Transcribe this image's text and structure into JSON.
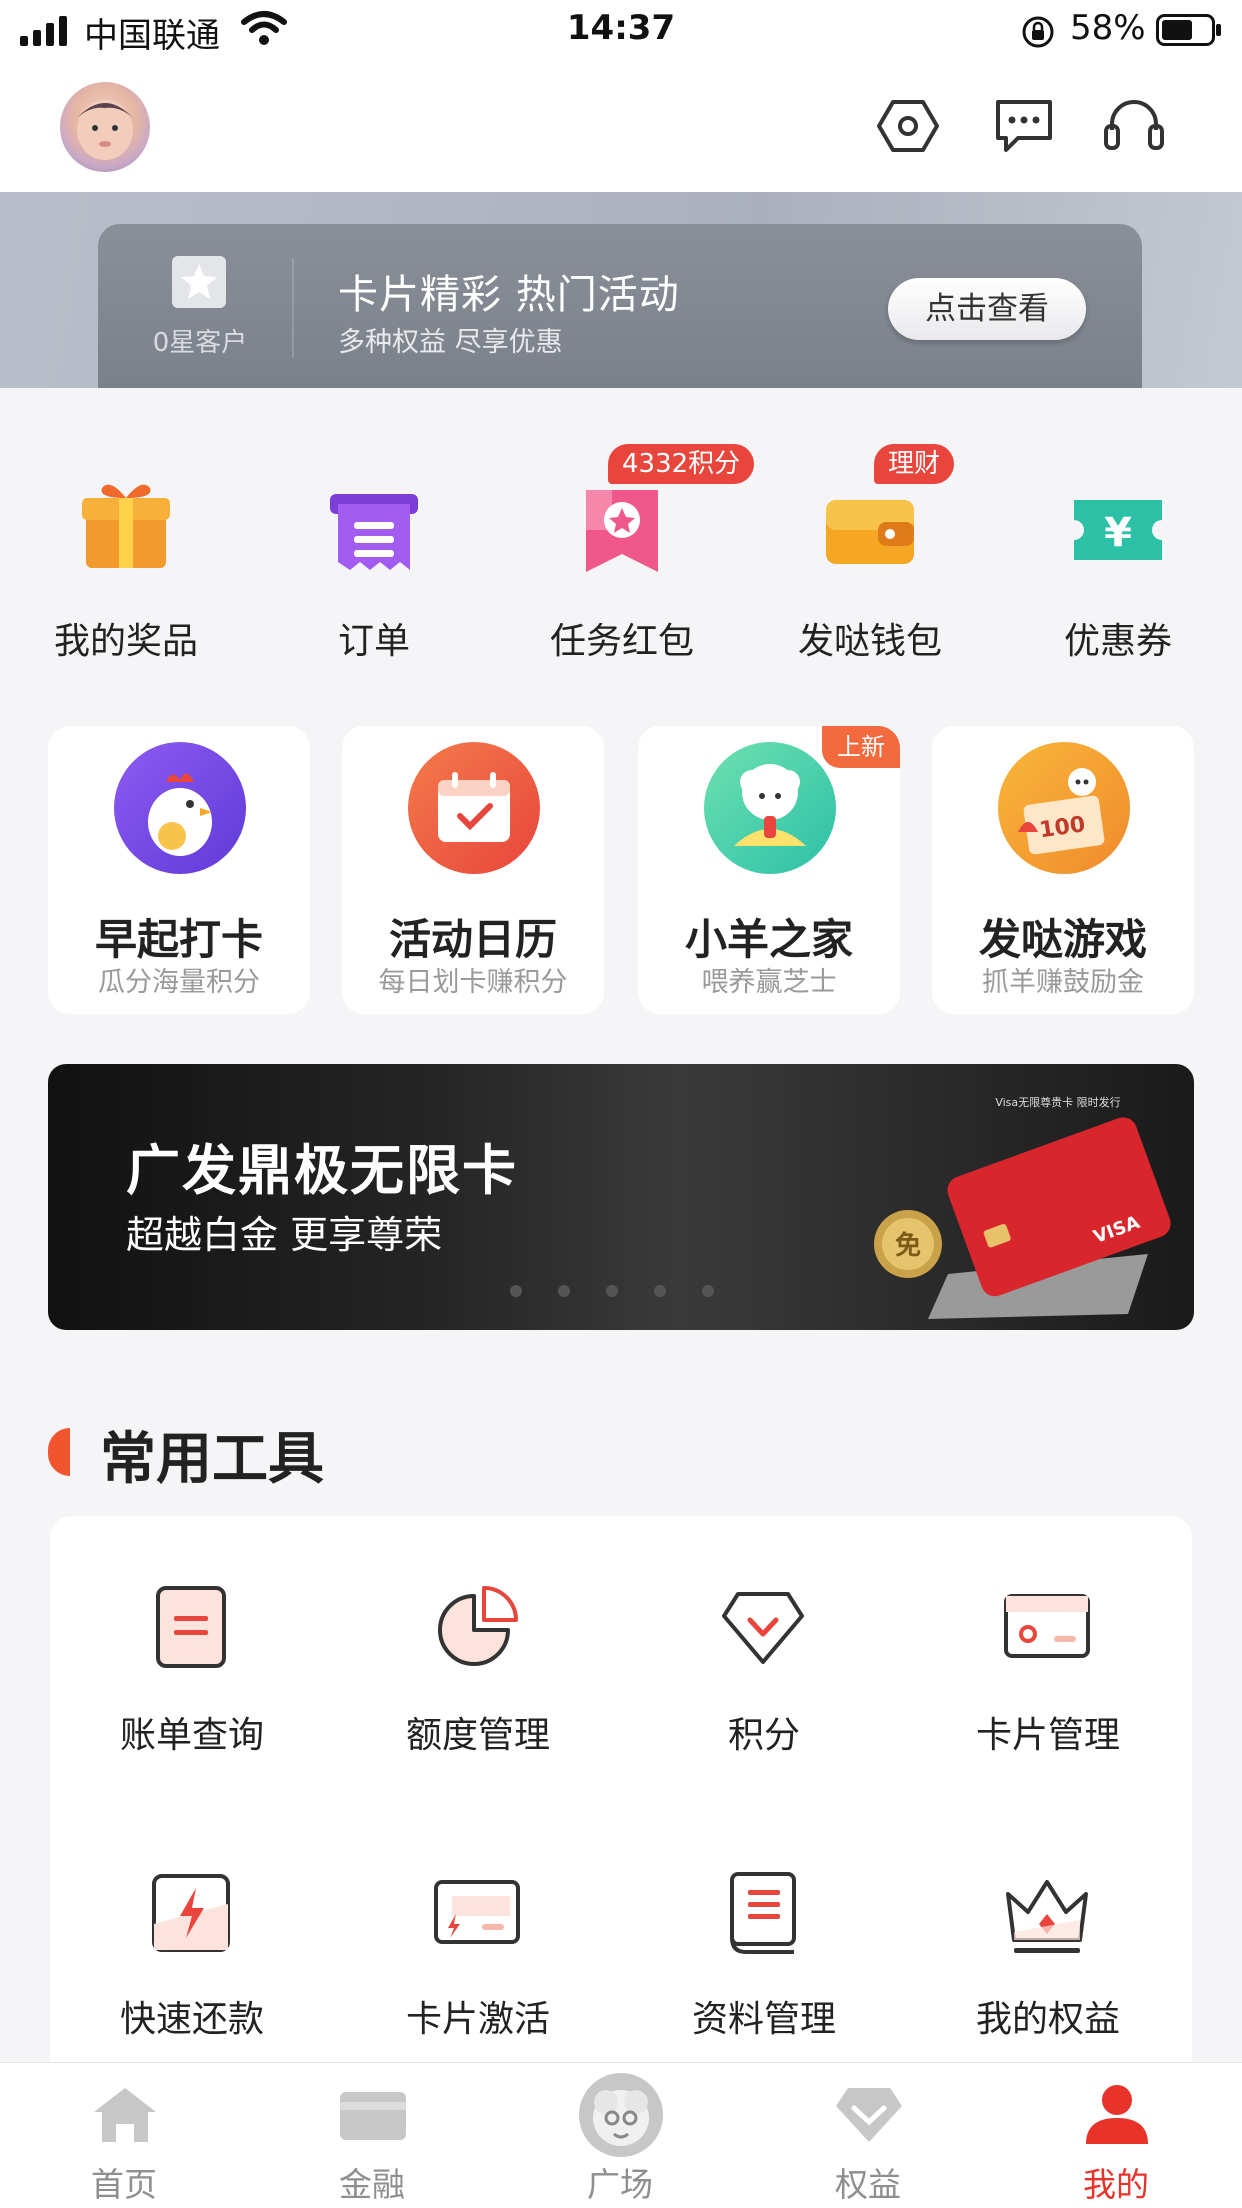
{
  "status_bar": {
    "carrier": "中国联通",
    "time": "14:37",
    "battery": "58%"
  },
  "header": {
    "icons": [
      "settings-icon",
      "message-icon",
      "customer-service-icon"
    ]
  },
  "member": {
    "level": "0星客户",
    "promo_title": "卡片精彩 热门活动",
    "promo_subtitle": "多种权益 尽享优惠",
    "button": "点击查看"
  },
  "quick_links": [
    {
      "label": "我的奖品",
      "icon": "gift-icon"
    },
    {
      "label": "订单",
      "icon": "order-icon"
    },
    {
      "label": "任务红包",
      "icon": "task-redpacket-icon",
      "badge": "4332积分"
    },
    {
      "label": "发哒钱包",
      "icon": "wallet-icon",
      "badge": "理财"
    },
    {
      "label": "优惠券",
      "icon": "coupon-icon"
    }
  ],
  "feature_cards": [
    {
      "title": "早起打卡",
      "subtitle": "瓜分海量积分",
      "icon": "rooster-icon"
    },
    {
      "title": "活动日历",
      "subtitle": "每日划卡赚积分",
      "icon": "calendar-icon"
    },
    {
      "title": "小羊之家",
      "subtitle": "喂养赢芝士",
      "icon": "sheep-icon",
      "tag": "上新"
    },
    {
      "title": "发哒游戏",
      "subtitle": "抓羊赚鼓励金",
      "icon": "game-icon"
    }
  ],
  "card_banner": {
    "title": "广发鼎极无限卡",
    "subtitle": "超越白金 更享尊荣",
    "card_text": "Visa无限尊贵卡 限时发行",
    "badge": "免",
    "slide_count": 5
  },
  "tools": {
    "title": "常用工具",
    "items": [
      {
        "label": "账单查询",
        "icon": "bill-icon"
      },
      {
        "label": "额度管理",
        "icon": "pie-chart-icon"
      },
      {
        "label": "积分",
        "icon": "diamond-icon"
      },
      {
        "label": "卡片管理",
        "icon": "card-settings-icon"
      },
      {
        "label": "快速还款",
        "icon": "fast-repay-icon"
      },
      {
        "label": "卡片激活",
        "icon": "card-activate-icon"
      },
      {
        "label": "资料管理",
        "icon": "profile-book-icon"
      },
      {
        "label": "我的权益",
        "icon": "crown-icon"
      }
    ]
  },
  "tabbar": {
    "items": [
      {
        "label": "首页",
        "icon": "home-icon"
      },
      {
        "label": "金融",
        "icon": "finance-card-icon"
      },
      {
        "label": "广场",
        "icon": "square-avatar-icon"
      },
      {
        "label": "权益",
        "icon": "benefits-icon"
      },
      {
        "label": "我的",
        "icon": "profile-icon",
        "active": true
      }
    ]
  },
  "colors": {
    "accent": "#e8332b",
    "badge": "#e8453c",
    "tab_inactive": "#8e8e8e"
  }
}
